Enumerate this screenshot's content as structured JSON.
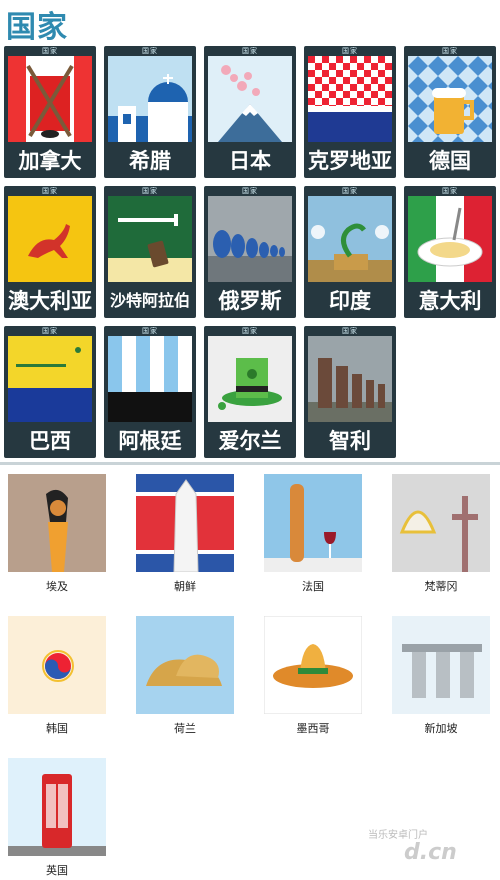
{
  "header": {
    "title": "国家"
  },
  "card_tag": "国家",
  "cards_row1": [
    "加拿大",
    "希腊",
    "日本",
    "克罗地亚",
    "德国"
  ],
  "cards_row2": [
    "澳大利亚",
    "沙特阿拉伯",
    "俄罗斯",
    "印度",
    "意大利"
  ],
  "cards_row3": [
    "巴西",
    "阿根廷",
    "爱尔兰",
    "智利"
  ],
  "tiles_row1": [
    "埃及",
    "朝鲜",
    "法国",
    "梵蒂冈"
  ],
  "tiles_row2": [
    "韩国",
    "荷兰",
    "墨西哥",
    "新加坡"
  ],
  "tiles_row3": [
    "英国"
  ],
  "watermark": {
    "line1": "当乐安卓门户",
    "line2": "d.cn"
  }
}
